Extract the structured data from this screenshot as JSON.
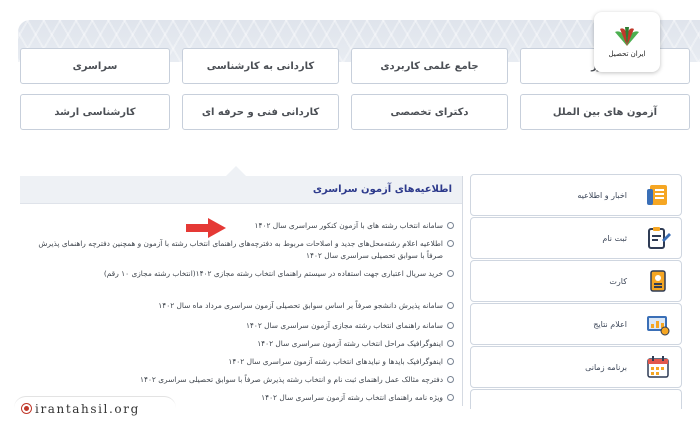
{
  "exam_nav": {
    "row1": [
      "کنکور",
      "جامع علمی کاربردی",
      "کاردانی به کارشناسی",
      "سراسری"
    ],
    "row2": [
      "آزمون های بین الملل",
      "دکترای تخصصی",
      "کاردانی فنی و حرفه ای",
      "کارشناسی ارشد"
    ]
  },
  "news_panel": {
    "title": "اطلاعیه‌های آزمون سراسری",
    "items": [
      "سامانه انتخاب رشته های با آزمون کنکور سراسری سال ۱۴۰۲",
      "اطلاعیه اعلام رشته‌محل‌های جدید و اصلاحات مربوط به دفترچه‌های راهنمای انتخاب رشته با آزمون و همچنین دفترچه راهنمای پذیرش صرفاً با سوابق تحصیلی سراسری سال ۱۴۰۲",
      "خرید سریال اعتباری جهت استفاده در سیستم راهنمای انتخاب رشته مجازی ۱۴۰۲(انتخاب رشته مجازی ۱۰ رقم)",
      "سامانه پذیرش دانشجو صرفاً بر اساس سوابق تحصیلی آزمون سراسری مرداد ماه سال ۱۴۰۲",
      "سامانه راهنمای انتخاب رشته مجازی آزمون سراسری سال ۱۴۰۲",
      "اینفوگرافیک مراحل انتخاب رشته آزمون سراسری سال ۱۴۰۲",
      "اینفوگرافیک بایدها و نبایدهای انتخاب رشته آزمون سراسری سال ۱۴۰۲",
      "دفترچه مثالک عمل راهنمای ثبت نام و انتخاب رشته پذیرش صرفاً با سوابق تحصیلی سراسری ۱۴۰۲",
      "ویژه نامه راهنمای انتخاب رشته آزمون سراسری سال ۱۴۰۲"
    ]
  },
  "sidebar": {
    "items": [
      {
        "label": "اخبار و اطلاعیه",
        "icon": "news-icon"
      },
      {
        "label": "ثبت نام",
        "icon": "registration-icon"
      },
      {
        "label": "کارت",
        "icon": "card-icon"
      },
      {
        "label": "اعلام نتایج",
        "icon": "results-icon"
      },
      {
        "label": "برنامه زمانی",
        "icon": "calendar-icon"
      }
    ]
  },
  "logo": {
    "name": "ایران تحصیل"
  },
  "site": {
    "url": "irantahsil.org"
  },
  "colors": {
    "accent_red": "#e53935",
    "title_blue": "#2d3a8c",
    "logo_green": "#4caf50",
    "logo_red": "#c0392b"
  }
}
